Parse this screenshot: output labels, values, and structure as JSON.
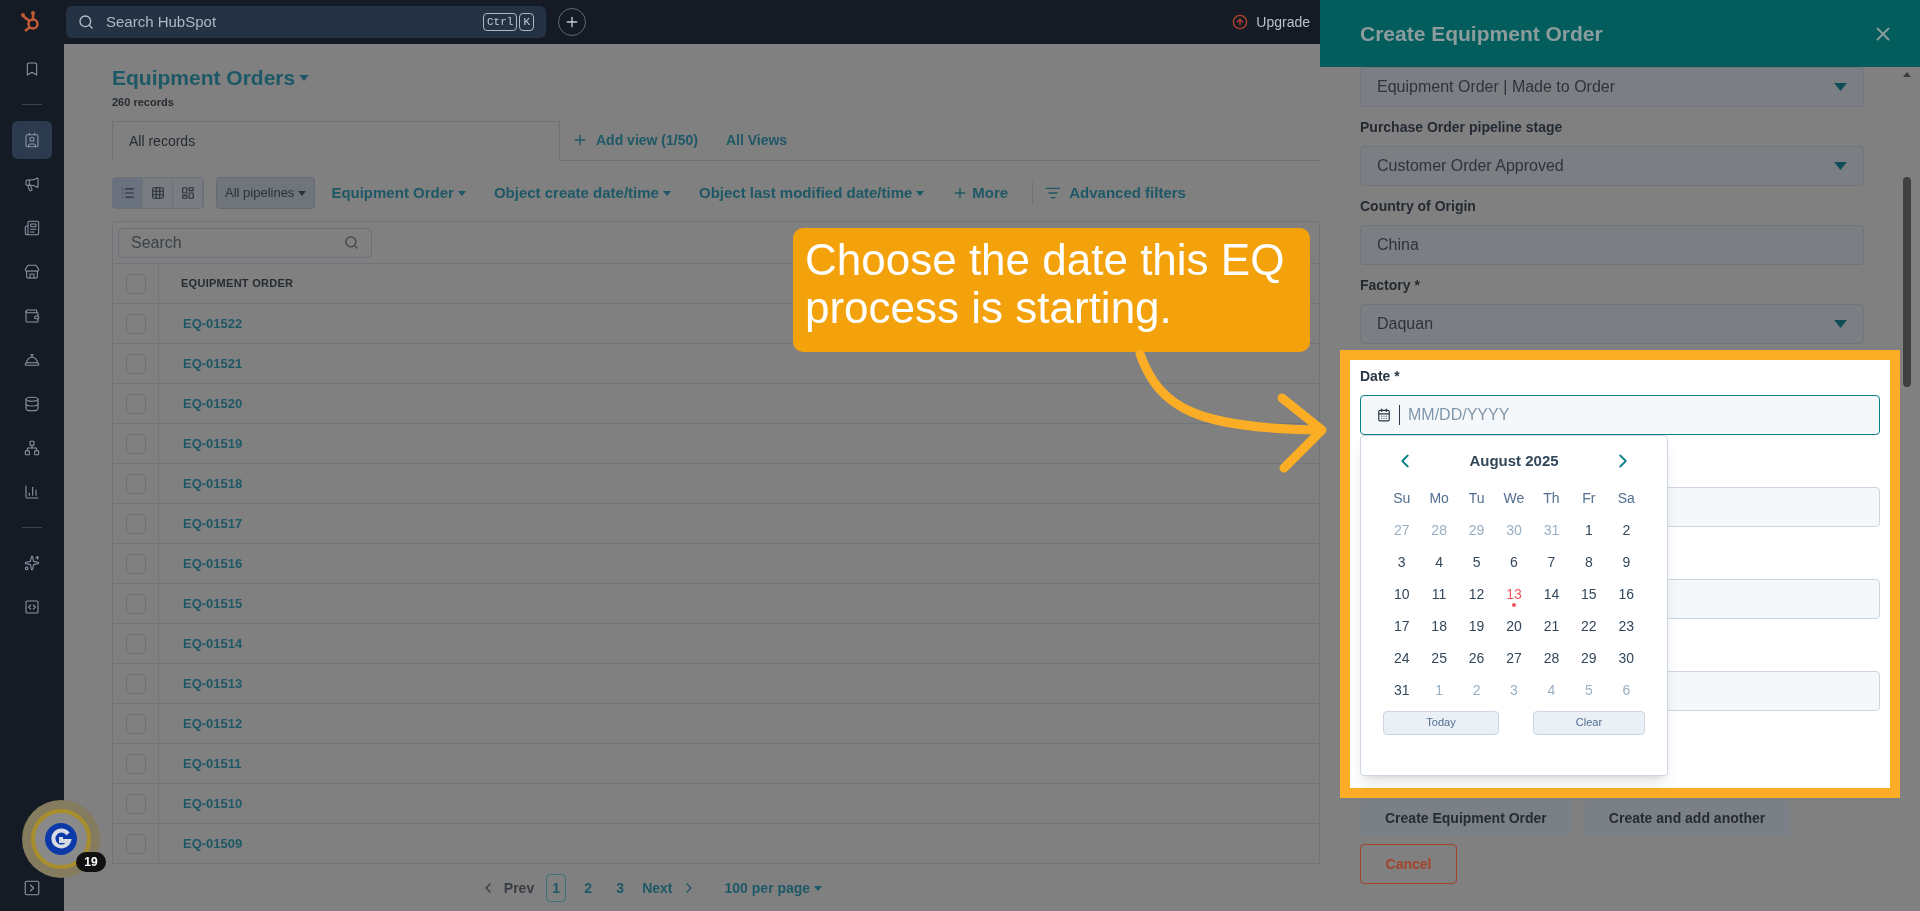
{
  "topbar": {
    "search_placeholder": "Search HubSpot",
    "shortcut_keys": [
      "Ctrl",
      "K"
    ],
    "upgrade": "Upgrade"
  },
  "sidebar": {
    "items": [
      {
        "selected": false
      },
      {
        "selected": true
      },
      {
        "selected": false
      },
      {
        "selected": false
      },
      {
        "selected": false
      },
      {
        "selected": false
      },
      {
        "selected": false
      },
      {
        "selected": false
      },
      {
        "selected": false
      },
      {
        "selected": false
      },
      {
        "selected": false
      },
      {
        "selected": false
      }
    ]
  },
  "page": {
    "title": "Equipment Orders",
    "record_count": "260 records",
    "tabs": [
      {
        "label": "All records",
        "selected": true
      }
    ],
    "add_view": "Add view (1/50)",
    "all_views": "All Views",
    "view_modes": [
      {
        "selected": true
      },
      {
        "selected": false
      },
      {
        "selected": false
      }
    ],
    "filters": [
      {
        "label": "All pipelines",
        "kind": "select"
      },
      {
        "label": "Equipment Order",
        "kind": "dropdown"
      },
      {
        "label": "Object create date/time",
        "kind": "dropdown"
      },
      {
        "label": "Object last modified date/time",
        "kind": "dropdown"
      },
      {
        "label": "More",
        "kind": "add"
      },
      {
        "label": "Advanced filters",
        "kind": "advanced"
      }
    ]
  },
  "table": {
    "search_placeholder": "Search",
    "header_checked": false,
    "columns": [
      "EQUIPMENT ORDER"
    ],
    "rows": [
      {
        "id": "EQ-01522",
        "checked": false
      },
      {
        "id": "EQ-01521",
        "checked": false
      },
      {
        "id": "EQ-01520",
        "checked": false
      },
      {
        "id": "EQ-01519",
        "checked": false
      },
      {
        "id": "EQ-01518",
        "checked": false
      },
      {
        "id": "EQ-01517",
        "checked": false
      },
      {
        "id": "EQ-01516",
        "checked": false
      },
      {
        "id": "EQ-01515",
        "checked": false
      },
      {
        "id": "EQ-01514",
        "checked": false
      },
      {
        "id": "EQ-01513",
        "checked": false
      },
      {
        "id": "EQ-01512",
        "checked": false
      },
      {
        "id": "EQ-01511",
        "checked": false
      },
      {
        "id": "EQ-01510",
        "checked": false
      },
      {
        "id": "EQ-01509",
        "checked": false
      }
    ]
  },
  "pagination": {
    "prev": "Prev",
    "pages": [
      {
        "label": "1",
        "selected": true
      },
      {
        "label": "2",
        "selected": false
      },
      {
        "label": "3",
        "selected": false
      }
    ],
    "next": "Next",
    "per_page": "100 per page"
  },
  "helper_badge": {
    "count": "19"
  },
  "panel": {
    "title": "Create Equipment Order",
    "fields": [
      {
        "value": "Equipment Order | Made to Order",
        "kind": "select"
      },
      {
        "label": "Purchase Order pipeline stage",
        "value": "Customer Order Approved",
        "kind": "select"
      },
      {
        "label": "Country of Origin",
        "value": "China",
        "kind": "text"
      },
      {
        "label": "Factory *",
        "value": "Daquan",
        "kind": "select"
      }
    ],
    "date_field": {
      "label": "Date *",
      "placeholder": "MM/DD/YYYY"
    },
    "calendar": {
      "month": "August 2025",
      "weekdays": [
        "Su",
        "Mo",
        "Tu",
        "We",
        "Th",
        "Fr",
        "Sa"
      ],
      "days": [
        {
          "label": "27",
          "outside": true,
          "today": false
        },
        {
          "label": "28",
          "outside": true,
          "today": false
        },
        {
          "label": "29",
          "outside": true,
          "today": false
        },
        {
          "label": "30",
          "outside": true,
          "today": false
        },
        {
          "label": "31",
          "outside": true,
          "today": false
        },
        {
          "label": "1",
          "outside": false,
          "today": false
        },
        {
          "label": "2",
          "outside": false,
          "today": false
        },
        {
          "label": "3",
          "outside": false,
          "today": false
        },
        {
          "label": "4",
          "outside": false,
          "today": false
        },
        {
          "label": "5",
          "outside": false,
          "today": false
        },
        {
          "label": "6",
          "outside": false,
          "today": false
        },
        {
          "label": "7",
          "outside": false,
          "today": false
        },
        {
          "label": "8",
          "outside": false,
          "today": false
        },
        {
          "label": "9",
          "outside": false,
          "today": false
        },
        {
          "label": "10",
          "outside": false,
          "today": false
        },
        {
          "label": "11",
          "outside": false,
          "today": false
        },
        {
          "label": "12",
          "outside": false,
          "today": false
        },
        {
          "label": "13",
          "outside": false,
          "today": true
        },
        {
          "label": "14",
          "outside": false,
          "today": false
        },
        {
          "label": "15",
          "outside": false,
          "today": false
        },
        {
          "label": "16",
          "outside": false,
          "today": false
        },
        {
          "label": "17",
          "outside": false,
          "today": false
        },
        {
          "label": "18",
          "outside": false,
          "today": false
        },
        {
          "label": "19",
          "outside": false,
          "today": false
        },
        {
          "label": "20",
          "outside": false,
          "today": false
        },
        {
          "label": "21",
          "outside": false,
          "today": false
        },
        {
          "label": "22",
          "outside": false,
          "today": false
        },
        {
          "label": "23",
          "outside": false,
          "today": false
        },
        {
          "label": "24",
          "outside": false,
          "today": false
        },
        {
          "label": "25",
          "outside": false,
          "today": false
        },
        {
          "label": "26",
          "outside": false,
          "today": false
        },
        {
          "label": "27",
          "outside": false,
          "today": false
        },
        {
          "label": "28",
          "outside": false,
          "today": false
        },
        {
          "label": "29",
          "outside": false,
          "today": false
        },
        {
          "label": "30",
          "outside": false,
          "today": false
        },
        {
          "label": "31",
          "outside": false,
          "today": false
        },
        {
          "label": "1",
          "outside": true,
          "today": false
        },
        {
          "label": "2",
          "outside": true,
          "today": false
        },
        {
          "label": "3",
          "outside": true,
          "today": false
        },
        {
          "label": "4",
          "outside": true,
          "today": false
        },
        {
          "label": "5",
          "outside": true,
          "today": false
        },
        {
          "label": "6",
          "outside": true,
          "today": false
        }
      ],
      "buttons": [
        "Today",
        "Clear"
      ]
    },
    "actions": [
      "Create Equipment Order",
      "Create and add another"
    ],
    "cancel": "Cancel"
  },
  "callout": {
    "text": "Choose the date this EQ process is starting."
  }
}
